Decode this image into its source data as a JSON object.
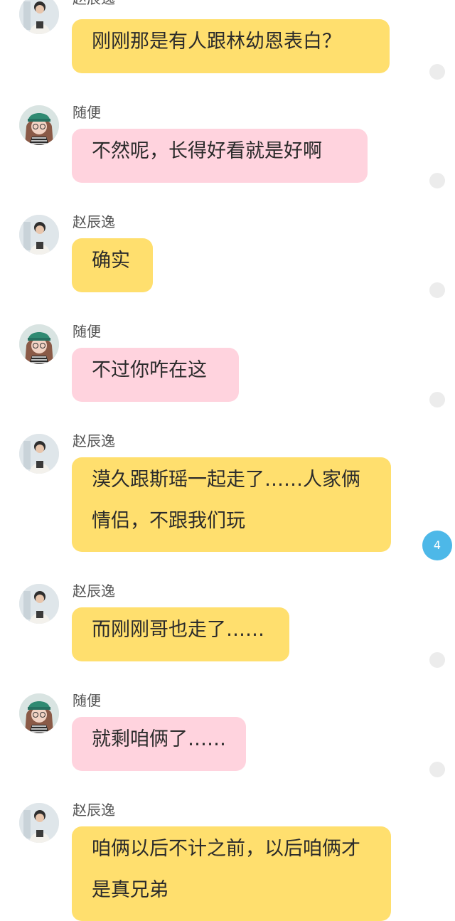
{
  "chat": {
    "messages": [
      {
        "sender": "赵辰逸",
        "text": "刚刚那是有人跟林幼恩表白？",
        "style": "yellow"
      },
      {
        "sender": "随便",
        "text": "不然呢，长得好看就是好啊",
        "style": "pink"
      },
      {
        "sender": "赵辰逸",
        "text": "确实",
        "style": "yellow"
      },
      {
        "sender": "随便",
        "text": "不过你咋在这",
        "style": "pink"
      },
      {
        "sender": "赵辰逸",
        "text": "漠久跟斯瑶一起走了……人家俩情侣，不跟我们玩",
        "style": "yellow"
      },
      {
        "sender": "赵辰逸",
        "text": "而刚刚哥也走了……",
        "style": "yellow"
      },
      {
        "sender": "随便",
        "text": "就剩咱俩了……",
        "style": "pink"
      },
      {
        "sender": "赵辰逸",
        "text": "咱俩以后不计之前，以后咱俩才是真兄弟",
        "style": "yellow"
      }
    ],
    "unread_badge": "4"
  },
  "colors": {
    "bubble_yellow": "#ffdf6e",
    "bubble_pink": "#ffd3de",
    "badge_blue": "#4db8e8"
  }
}
